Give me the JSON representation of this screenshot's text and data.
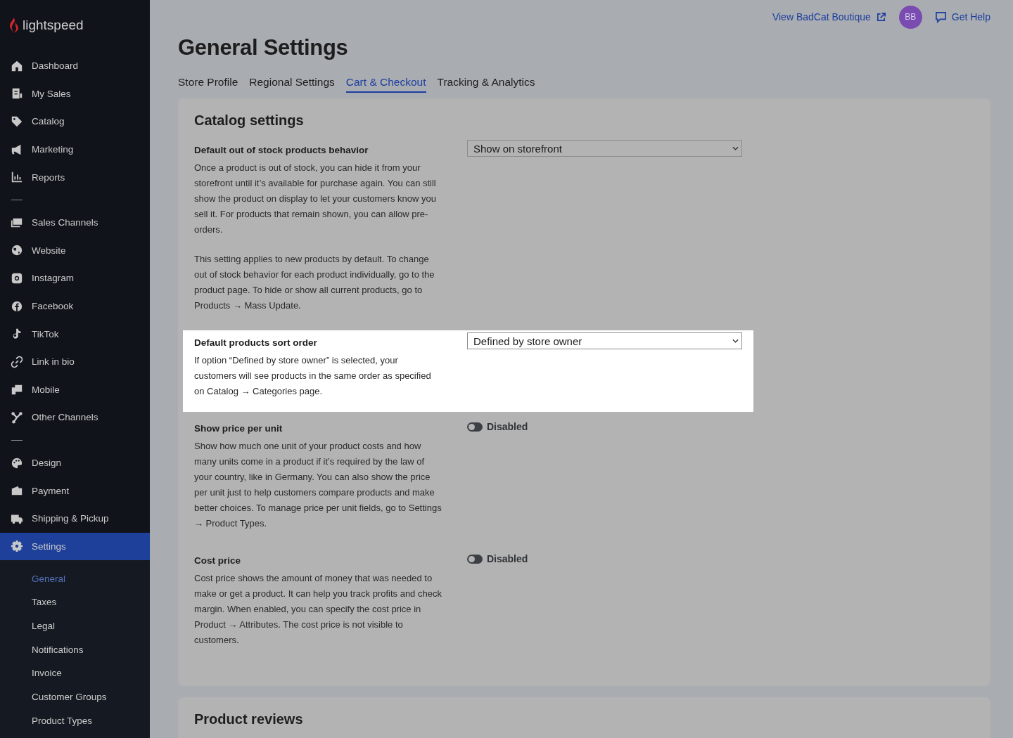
{
  "sidebar": {
    "logo": "lightspeed",
    "groups": [
      [
        {
          "label": "Dashboard",
          "selected": false
        },
        {
          "label": "My Sales",
          "selected": false
        },
        {
          "label": "Catalog",
          "selected": false
        },
        {
          "label": "Marketing",
          "selected": false
        },
        {
          "label": "Reports",
          "selected": false
        }
      ],
      [
        {
          "label": "Sales Channels",
          "selected": false
        },
        {
          "label": "Website",
          "selected": false
        },
        {
          "label": "Instagram",
          "selected": false
        },
        {
          "label": "Facebook",
          "selected": false
        },
        {
          "label": "TikTok",
          "selected": false
        },
        {
          "label": "Link in bio",
          "selected": false
        },
        {
          "label": "Mobile",
          "selected": false
        },
        {
          "label": "Other Channels",
          "selected": false
        }
      ],
      [
        {
          "label": "Design",
          "selected": false
        },
        {
          "label": "Payment",
          "selected": false
        },
        {
          "label": "Shipping & Pickup",
          "selected": false
        },
        {
          "label": "Settings",
          "selected": true
        }
      ]
    ],
    "subitems": [
      {
        "label": "General",
        "selected": true
      },
      {
        "label": "Taxes",
        "selected": false
      },
      {
        "label": "Legal",
        "selected": false
      },
      {
        "label": "Notifications",
        "selected": false
      },
      {
        "label": "Invoice",
        "selected": false
      },
      {
        "label": "Customer Groups",
        "selected": false
      },
      {
        "label": "Product Types",
        "selected": false
      }
    ]
  },
  "header": {
    "store_link": "View BadCat Boutique",
    "avatar": "BB",
    "help": "Get Help"
  },
  "title": "General Settings",
  "tabs": [
    {
      "label": "Store Profile",
      "selected": false
    },
    {
      "label": "Regional Settings",
      "selected": false
    },
    {
      "label": "Cart & Checkout",
      "selected": true
    },
    {
      "label": "Tracking & Analytics",
      "selected": false
    }
  ],
  "card": {
    "title": "Catalog settings",
    "sections": [
      {
        "label": "Default out of stock products behavior",
        "highlighted": false,
        "paragraphs": [
          "Once a product is out of stock, you can hide it from your storefront until it’s available for purchase again. You can still show the product on display to let your customers know you sell it. For products that remain shown, you can allow pre-orders.",
          "This setting applies to new products by default. To change out of stock behavior for each product individually, go to the product page. To hide or show all current products, go to Products → Mass Update."
        ],
        "control": {
          "kind": "select",
          "value": "Show on storefront"
        }
      },
      {
        "label": "Default products sort order",
        "highlighted": true,
        "paragraphs": [
          "If option “Defined by store owner” is selected, your customers will see products in the same order as specified on Catalog → Categories page."
        ],
        "control": {
          "kind": "select",
          "value": "Defined by store owner"
        }
      },
      {
        "label": "Show price per unit",
        "highlighted": false,
        "paragraphs": [
          "Show how much one unit of your product costs and how many units come in a product if it’s required by the law of your country, like in Germany. You can also show the price per unit just to help customers compare products and make better choices. To manage price per unit fields, go to Settings → Product Types."
        ],
        "control": {
          "kind": "toggle",
          "on": false,
          "value": "Disabled"
        }
      },
      {
        "label": "Cost price",
        "highlighted": false,
        "paragraphs": [
          "Cost price shows the amount of money that was needed to make or get a product. It can help you track profits and check margin. When enabled, you can specify the cost price in Product → Attributes. The cost price is not visible to customers."
        ],
        "control": {
          "kind": "toggle",
          "on": false,
          "value": "Disabled"
        }
      }
    ]
  },
  "next_card": {
    "title": "Product reviews"
  }
}
